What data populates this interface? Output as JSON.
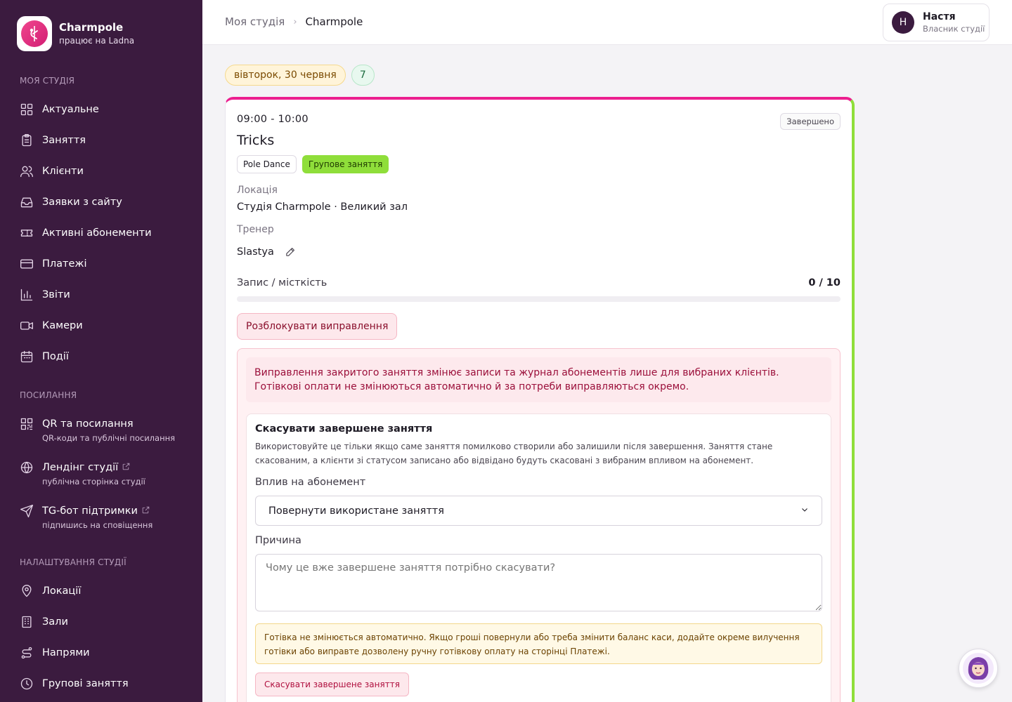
{
  "brand": {
    "name": "Charmpole",
    "subtitle": "працює на Ladna"
  },
  "sidebar": {
    "section_studio": "МОЯ СТУДІЯ",
    "studio_items": [
      {
        "label": "Актуальне",
        "icon": "grid-icon"
      },
      {
        "label": "Заняття",
        "icon": "clipboard-icon"
      },
      {
        "label": "Клієнти",
        "icon": "users-icon"
      },
      {
        "label": "Заявки з сайту",
        "icon": "inbox-icon"
      },
      {
        "label": "Активні абонементи",
        "icon": "ticket-icon"
      },
      {
        "label": "Платежі",
        "icon": "credit-card-icon"
      },
      {
        "label": "Звіти",
        "icon": "bar-chart-icon"
      },
      {
        "label": "Камери",
        "icon": "video-icon"
      },
      {
        "label": "Події",
        "icon": "calendar-icon"
      }
    ],
    "section_links": "ПОСИЛАННЯ",
    "link_items": [
      {
        "label": "QR та посилання",
        "sub": "QR-коди та публічні посилання",
        "icon": "qr-code-icon"
      },
      {
        "label": "Лендінг студії",
        "sub": "публічна сторінка студії",
        "icon": "globe-icon"
      },
      {
        "label": "TG-бот підтримки",
        "sub": "підпишись на сповіщення",
        "icon": "send-icon"
      }
    ],
    "section_settings": "НАЛАШТУВАННЯ СТУДІЇ",
    "settings_items": [
      {
        "label": "Локації",
        "icon": "map-pin-icon"
      },
      {
        "label": "Зали",
        "icon": "building-icon"
      },
      {
        "label": "Напрями",
        "icon": "route-icon"
      },
      {
        "label": "Групові заняття",
        "icon": "clock-icon"
      }
    ]
  },
  "breadcrumb": {
    "parent": "Моя студія",
    "current": "Charmpole"
  },
  "user": {
    "initial": "Н",
    "name": "Настя",
    "role": "Власник студії"
  },
  "date_header": {
    "date": "вівторок, 30 червня",
    "count": "7"
  },
  "session": {
    "time": "09:00 - 10:00",
    "status": "Завершено",
    "title": "Tricks",
    "tag_direction": "Pole Dance",
    "tag_type": "Групове заняття",
    "location_label": "Локація",
    "location_value": "Студія Charmpole · Великий зал",
    "trainer_label": "Тренер",
    "trainer_value": "Slastya",
    "capacity_label": "Запис / місткість",
    "capacity_value": "0 / 10",
    "capacity_fill": 0,
    "unlock_label": "Розблокувати виправлення"
  },
  "correction": {
    "warning": "Виправлення закритого заняття змінює записи та журнал абонементів лише для вибраних клієнтів. Готівкові оплати не змінюються автоматично й за потреби виправляються окремо.",
    "cancel_title": "Скасувати завершене заняття",
    "cancel_desc": "Використовуйте це тільки якщо саме заняття помилково створили або залишили після завершення. Заняття стане скасованим, а клієнти зі статусом записано або відвідано будуть скасовані з вибраним впливом на абонемент.",
    "impact_label": "Вплив на абонемент",
    "impact_selected": "Повернути використане заняття",
    "reason_label": "Причина",
    "reason_placeholder": "Чому це вже завершене заняття потрібно скасувати?",
    "cash_note": "Готівка не змінюється автоматично. Якщо гроші повернули або треба змінити баланс каси, додайте окреме вилучення готівки або виправте дозволену ручну готівкову оплату на сторінці Платежі.",
    "cancel_button": "Скасувати завершене заняття"
  },
  "colors": {
    "sidebar": "#3b1b3f",
    "accent_pink": "#ec1e8f",
    "accent_green": "#8fde3a"
  }
}
